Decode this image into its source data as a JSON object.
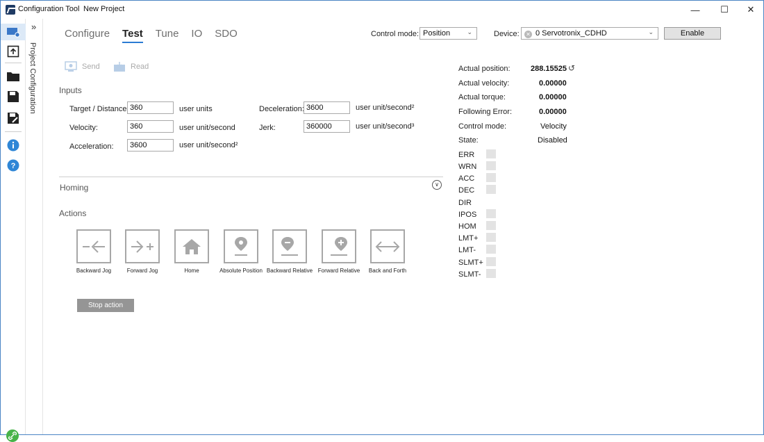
{
  "window": {
    "app_title": "Configuration Tool",
    "project_title": "New Project"
  },
  "sidebar": {
    "project_label": "Project Configuration",
    "icons": [
      "device-config-icon",
      "upload-icon",
      "open-folder-icon",
      "save-icon",
      "save-as-icon",
      "info-icon",
      "help-icon",
      "link-icon"
    ]
  },
  "tabs": [
    {
      "label": "Configure"
    },
    {
      "label": "Test"
    },
    {
      "label": "Tune"
    },
    {
      "label": "IO"
    },
    {
      "label": "SDO"
    }
  ],
  "header": {
    "control_mode_label": "Control mode:",
    "control_mode_value": "Position",
    "device_label": "Device:",
    "device_value": "0 Servotronix_CDHD",
    "enable_label": "Enable"
  },
  "toolbar": {
    "send_label": "Send",
    "read_label": "Read"
  },
  "inputs": {
    "title": "Inputs",
    "target_label": "Target / Distance:",
    "target_value": "360",
    "target_unit": "user units",
    "velocity_label": "Velocity:",
    "velocity_value": "360",
    "velocity_unit": "user unit/second",
    "acceleration_label": "Acceleration:",
    "acceleration_value": "3600",
    "acceleration_unit": "user unit/second²",
    "deceleration_label": "Deceleration:",
    "deceleration_value": "3600",
    "deceleration_unit": "user unit/second²",
    "jerk_label": "Jerk:",
    "jerk_value": "360000",
    "jerk_unit": "user unit/second³"
  },
  "homing": {
    "title": "Homing"
  },
  "actions": {
    "title": "Actions",
    "items": [
      {
        "label": "Backward Jog"
      },
      {
        "label": "Forward Jog"
      },
      {
        "label": "Home"
      },
      {
        "label": "Absolute Position"
      },
      {
        "label": "Backward Relative"
      },
      {
        "label": "Forward Relative"
      },
      {
        "label": "Back and Forth"
      }
    ],
    "stop_label": "Stop action"
  },
  "status": {
    "actual_position_label": "Actual position:",
    "actual_position_value": "288.15525",
    "actual_velocity_label": "Actual velocity:",
    "actual_velocity_value": "0.00000",
    "actual_torque_label": "Actual torque:",
    "actual_torque_value": "0.00000",
    "following_error_label": "Following Error:",
    "following_error_value": "0.00000",
    "control_mode_label": "Control mode:",
    "control_mode_value": "Velocity",
    "state_label": "State:",
    "state_value": "Disabled"
  },
  "flags": [
    {
      "label": "ERR",
      "box": true
    },
    {
      "label": "WRN",
      "box": true
    },
    {
      "label": "ACC",
      "box": true
    },
    {
      "label": "DEC",
      "box": true
    },
    {
      "label": "DIR",
      "box": false
    },
    {
      "label": "IPOS",
      "box": true
    },
    {
      "label": "HOM",
      "box": true
    },
    {
      "label": "LMT+",
      "box": true
    },
    {
      "label": "LMT-",
      "box": true
    },
    {
      "label": "SLMT+",
      "box": true
    },
    {
      "label": "SLMT-",
      "box": true
    }
  ],
  "colors": {
    "accent": "#2b7bd3",
    "sidebar_selected": "#dce9f7",
    "stop_button": "#959595",
    "link_icon": "#47b349"
  }
}
